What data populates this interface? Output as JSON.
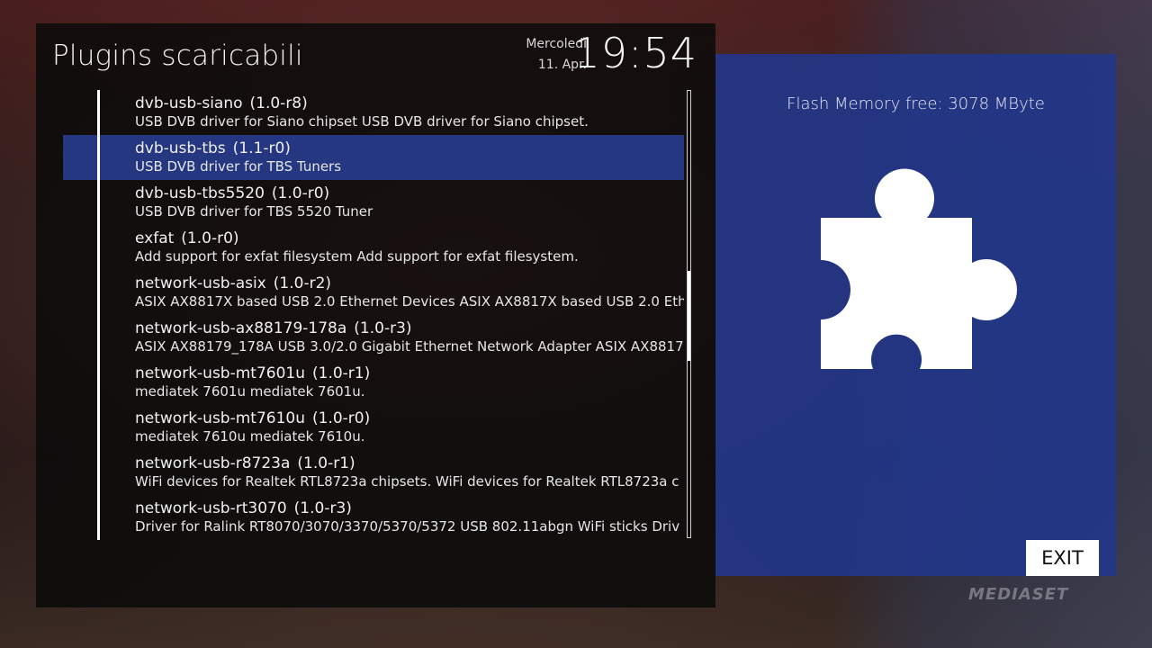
{
  "header": {
    "title": "Plugins scaricabili",
    "day": "Mercoledì",
    "date": "11. Apr.",
    "time": "19:54"
  },
  "plugins": [
    {
      "name": "dvb-usb-siano",
      "version": "(1.0-r8)",
      "description": "USB DVB driver for Siano chipset USB DVB driver for Siano chipset.",
      "selected": false
    },
    {
      "name": "dvb-usb-tbs",
      "version": "(1.1-r0)",
      "description": "USB DVB driver for TBS Tuners",
      "selected": true
    },
    {
      "name": "dvb-usb-tbs5520",
      "version": "(1.0-r0)",
      "description": "USB DVB driver for TBS 5520 Tuner",
      "selected": false
    },
    {
      "name": "exfat",
      "version": "(1.0-r0)",
      "description": "Add support for exfat filesystem Add support for exfat filesystem.",
      "selected": false
    },
    {
      "name": "network-usb-asix",
      "version": "(1.0-r2)",
      "description": "ASIX AX8817X based USB 2.0 Ethernet Devices ASIX AX8817X based USB 2.0 Eth",
      "selected": false
    },
    {
      "name": "network-usb-ax88179-178a",
      "version": "(1.0-r3)",
      "description": "ASIX AX88179_178A USB 3.0/2.0 Gigabit Ethernet Network Adapter ASIX AX8817",
      "selected": false
    },
    {
      "name": "network-usb-mt7601u",
      "version": "(1.0-r1)",
      "description": "mediatek 7601u mediatek 7601u.",
      "selected": false
    },
    {
      "name": "network-usb-mt7610u",
      "version": "(1.0-r0)",
      "description": "mediatek 7610u mediatek 7610u.",
      "selected": false
    },
    {
      "name": "network-usb-r8723a",
      "version": "(1.0-r1)",
      "description": "WiFi devices for Realtek RTL8723a chipsets. WiFi devices for Realtek RTL8723a c",
      "selected": false
    },
    {
      "name": "network-usb-rt3070",
      "version": "(1.0-r3)",
      "description": "Driver for Ralink RT8070/3070/3370/5370/5372 USB 802.11abgn WiFi sticks Driv",
      "selected": false
    }
  ],
  "side": {
    "flash_memory": "Flash Memory free: 3078 MByte",
    "icon": "puzzle-piece-icon"
  },
  "buttons": {
    "exit": "EXIT"
  },
  "background": {
    "watermark": "MEDIASET"
  },
  "colors": {
    "selection": "#243780",
    "side_panel": "#21378c"
  }
}
